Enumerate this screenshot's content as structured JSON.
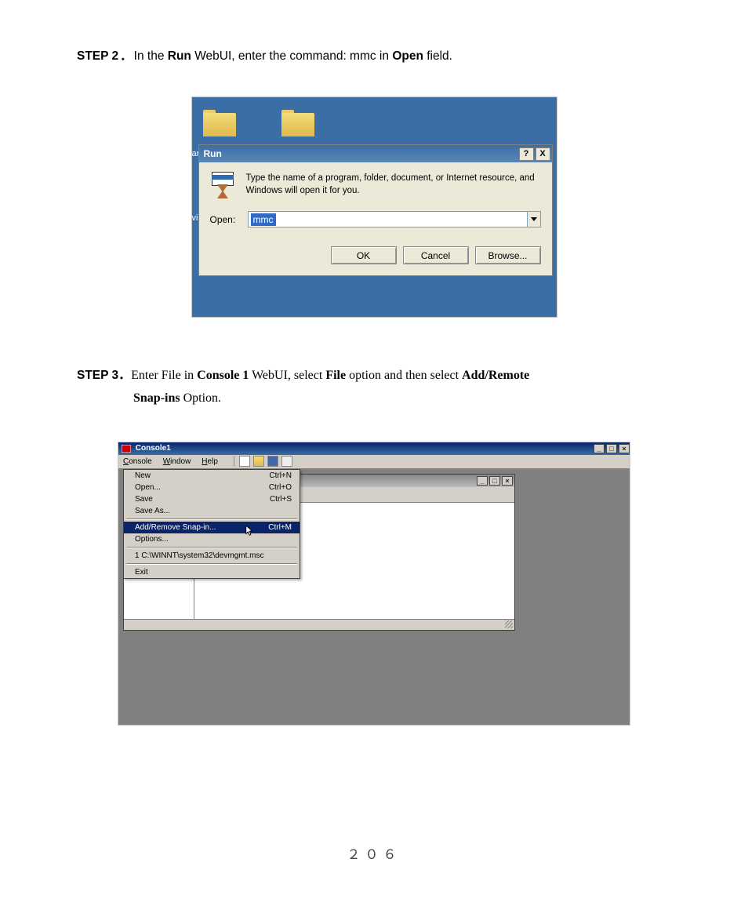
{
  "step2": {
    "label_step": "STEP 2",
    "dot": "．",
    "text_1": "In the ",
    "bold_run": "Run",
    "text_2": " WebUI, enter the command: mmc in ",
    "bold_open": "Open",
    "text_3": " field."
  },
  "runDialog": {
    "title": "Run",
    "helpBtn": "?",
    "closeBtn": "X",
    "description": "Type the name of a program, folder, document, or Internet resource, and Windows will open it for you.",
    "openLabel": "Open:",
    "openValue": "mmc",
    "okBtn": "OK",
    "cancelBtn": "Cancel",
    "browseBtn": "Browse..."
  },
  "step3": {
    "label_step": "STEP 3",
    "dot": "．",
    "text_1": "Enter File in ",
    "bold_console": "Console 1",
    "text_2": " WebUI, select ",
    "bold_file": "File",
    "text_3": " option and then select ",
    "bold_add": "Add/Remote",
    "line2_bold": "Snap-ins",
    "line2_text": " Option."
  },
  "console": {
    "title": "Console1",
    "menu": {
      "console": "Console",
      "window": "Window",
      "help": "Help"
    },
    "fileMenu": {
      "new": "New",
      "new_sc": "Ctrl+N",
      "open": "Open...",
      "open_sc": "Ctrl+O",
      "save": "Save",
      "save_sc": "Ctrl+S",
      "saveAs": "Save As...",
      "addRemove": "Add/Remove Snap-in...",
      "addRemove_sc": "Ctrl+M",
      "options": "Options...",
      "recent": "1 C:\\WINNT\\system32\\devmgmt.msc",
      "exit": "Exit"
    },
    "minBtn": "_",
    "maxBtn": "□",
    "closeBtn": "×"
  },
  "pageNumber": "２０６"
}
